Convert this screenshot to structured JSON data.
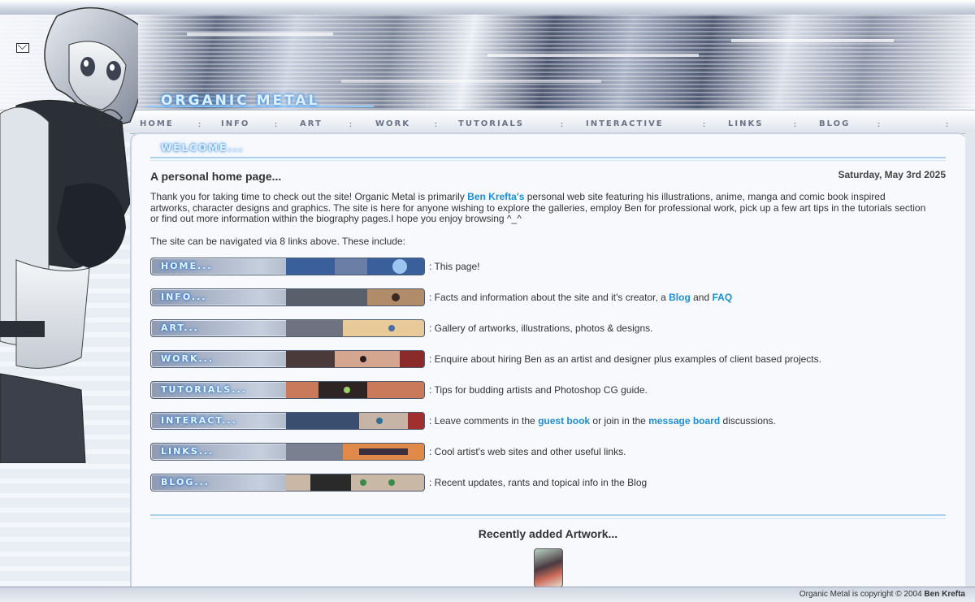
{
  "site": {
    "title": "ORGANIC METAL"
  },
  "icons": {
    "mail": "mail-icon"
  },
  "nav": [
    {
      "label": "HOME"
    },
    {
      "label": "INFO"
    },
    {
      "label": "ART"
    },
    {
      "label": "WORK"
    },
    {
      "label": "TUTORIALS"
    },
    {
      "label": "INTERACTIVE"
    },
    {
      "label": "LINKS"
    },
    {
      "label": "BLOG"
    }
  ],
  "nav_separator": ":",
  "section": {
    "label": "WELCOME..."
  },
  "main": {
    "heading": "A personal home page...",
    "date": "Saturday, May 3rd 2025",
    "intro_before": "Thank you for taking time to check out the site! Organic Metal is primarily ",
    "intro_link": "Ben Krefta's",
    "intro_after": " personal web site featuring his illustrations, anime, manga and comic book inspired artworks, character designs and graphics. The site is here for anyone wishing to explore the galleries, employ Ben for professional work, pick up a few art tips in the tutorials section or find out more information within the biography pages.I hope you enjoy browsing ^_^",
    "nav_intro": "The site can be navigated via 8 links above. These include:"
  },
  "links": [
    {
      "button": "HOME...",
      "desc": ": This page!"
    },
    {
      "button": "INFO...",
      "desc_before": ": Facts and information about the site and it's creator, a ",
      "link1": "Blog",
      "desc_mid": " and ",
      "link2": "FAQ"
    },
    {
      "button": "ART...",
      "desc": ": Gallery of artworks, illustrations, photos & designs."
    },
    {
      "button": "WORK...",
      "desc": ": Enquire about hiring Ben as an artist and designer plus examples of client based projects."
    },
    {
      "button": "TUTORIALS...",
      "desc": ": Tips for budding artists and Photoshop CG guide."
    },
    {
      "button": "INTERACT...",
      "desc_before": ": Leave comments in the ",
      "link1": "guest book",
      "desc_mid": " or join in the ",
      "link2": "message board",
      "desc_after": " discussions."
    },
    {
      "button": "LINKS...",
      "desc": ": Cool artist's web sites and other useful links."
    },
    {
      "button": "BLOG...",
      "desc": ": Recent updates, rants and topical info in the Blog"
    }
  ],
  "recent": {
    "heading": "Recently added Artwork..."
  },
  "footer": {
    "text": "Organic Metal is copyright © 2004",
    "author": "Ben Krefta"
  },
  "colors": {
    "link": "#1b8fd6",
    "accent_rule": "#a9d2f0",
    "glow": "#3b8fe0"
  }
}
